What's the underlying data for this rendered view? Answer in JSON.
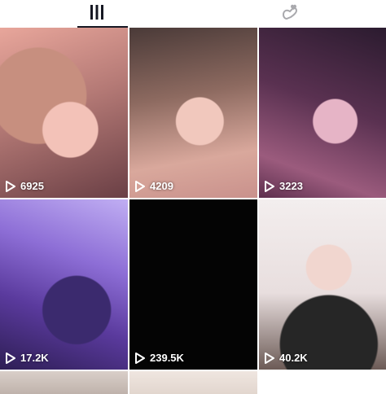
{
  "tabs": [
    {
      "name": "videos",
      "icon": "grid-icon"
    },
    {
      "name": "liked",
      "icon": "liked-hand-heart-icon"
    }
  ],
  "videos": [
    {
      "views": "6925"
    },
    {
      "views": "4209"
    },
    {
      "views": "3223"
    },
    {
      "views": "17.2K"
    },
    {
      "views": "239.5K"
    },
    {
      "views": "40.2K"
    },
    {
      "views": ""
    },
    {
      "views": ""
    },
    {
      "views": ""
    }
  ],
  "colors": {
    "text_overlay": "#ffffff",
    "tab_active": "#161823",
    "tab_inactive": "#a9a9ad"
  }
}
